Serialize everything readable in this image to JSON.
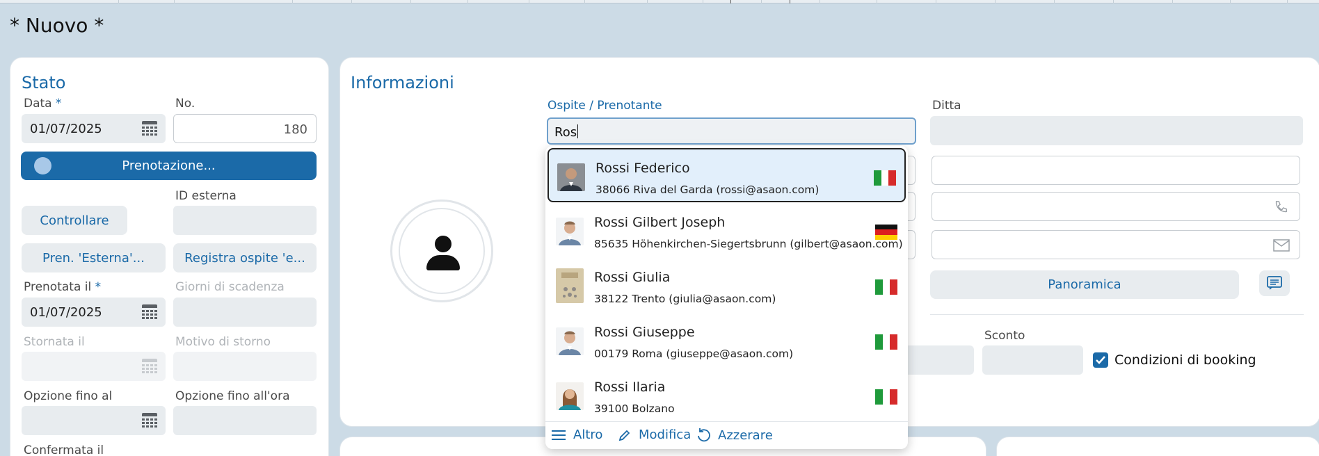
{
  "window": {
    "title": "* Nuovo *"
  },
  "stato": {
    "title": "Stato",
    "data_label": "Data",
    "data_value": "01/07/2025",
    "no_label": "No.",
    "no_value": "180",
    "prenotazione_button": "Prenotazione...",
    "controllare_button": "Controllare",
    "id_esterna_label": "ID esterna",
    "pren_esterna_button": "Pren. 'Esterna'...",
    "registra_ospite_button": "Registra ospite 'e...",
    "prenotata_il_label": "Prenotata il",
    "prenotata_il_value": "01/07/2025",
    "giorni_scadenza_label": "Giorni di scadenza",
    "stornata_il_label": "Stornata il",
    "motivo_storno_label": "Motivo di storno",
    "opzione_fino_al_label": "Opzione fino al",
    "opzione_fino_ora_label": "Opzione fino all'ora",
    "confermata_il_label": "Confermata il",
    "required_marker": "*"
  },
  "informazioni": {
    "title": "Informazioni",
    "ospite_label": "Ospite / Prenotante",
    "ospite_value": "Ros",
    "ditta_label": "Ditta",
    "panoramica_button": "Panoramica",
    "sconto_label": "Sconto",
    "condizioni_label": "Condizioni di booking"
  },
  "dropdown": {
    "items": [
      {
        "name": "Rossi Federico",
        "detail": "38066 Riva del Garda (rossi@asaon.com)",
        "flag": "italy-flag-icon"
      },
      {
        "name": "Rossi Gilbert Joseph",
        "detail": "85635 Höhenkirchen-Siegertsbrunn (gilbert@asaon.com)",
        "flag": "germany-flag-icon"
      },
      {
        "name": "Rossi Giulia",
        "detail": "38122 Trento (giulia@asaon.com)",
        "flag": "italy-flag-icon"
      },
      {
        "name": "Rossi Giuseppe",
        "detail": "00179 Roma (giuseppe@asaon.com)",
        "flag": "italy-flag-icon"
      },
      {
        "name": "Rossi Ilaria",
        "detail": "39100 Bolzano",
        "flag": "italy-flag-icon"
      }
    ],
    "footer": {
      "altro": "Altro",
      "modifica": "Modifica",
      "azzerare": "Azzerare"
    }
  },
  "colors": {
    "accent": "#1b6aa8",
    "background": "#ccdbe6"
  }
}
